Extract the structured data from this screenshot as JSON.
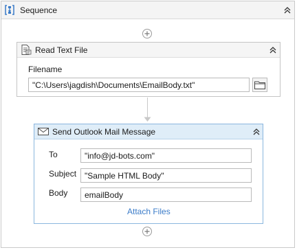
{
  "sequence": {
    "title": "Sequence",
    "icon": "sequence-icon",
    "collapse_icon": "double-chevron-up-icon",
    "add_icon": "plus-circle-icon"
  },
  "read_text_file": {
    "title": "Read Text File",
    "icon": "text-file-icon",
    "filename_label": "Filename",
    "filename_value": "\"C:\\Users\\jagdish\\Documents\\EmailBody.txt\"",
    "browse_icon": "folder-icon"
  },
  "send_mail": {
    "title": "Send Outlook Mail Message",
    "icon": "envelope-icon",
    "to_label": "To",
    "to_value": "\"info@jd-bots.com\"",
    "subject_label": "Subject",
    "subject_value": "\"Sample HTML Body\"",
    "body_label": "Body",
    "body_value": "emailBody",
    "attach_label": "Attach Files"
  },
  "colors": {
    "accent_link": "#3a7bc8",
    "selected_header": "#dfedf8",
    "selected_border": "#8ab6de"
  }
}
